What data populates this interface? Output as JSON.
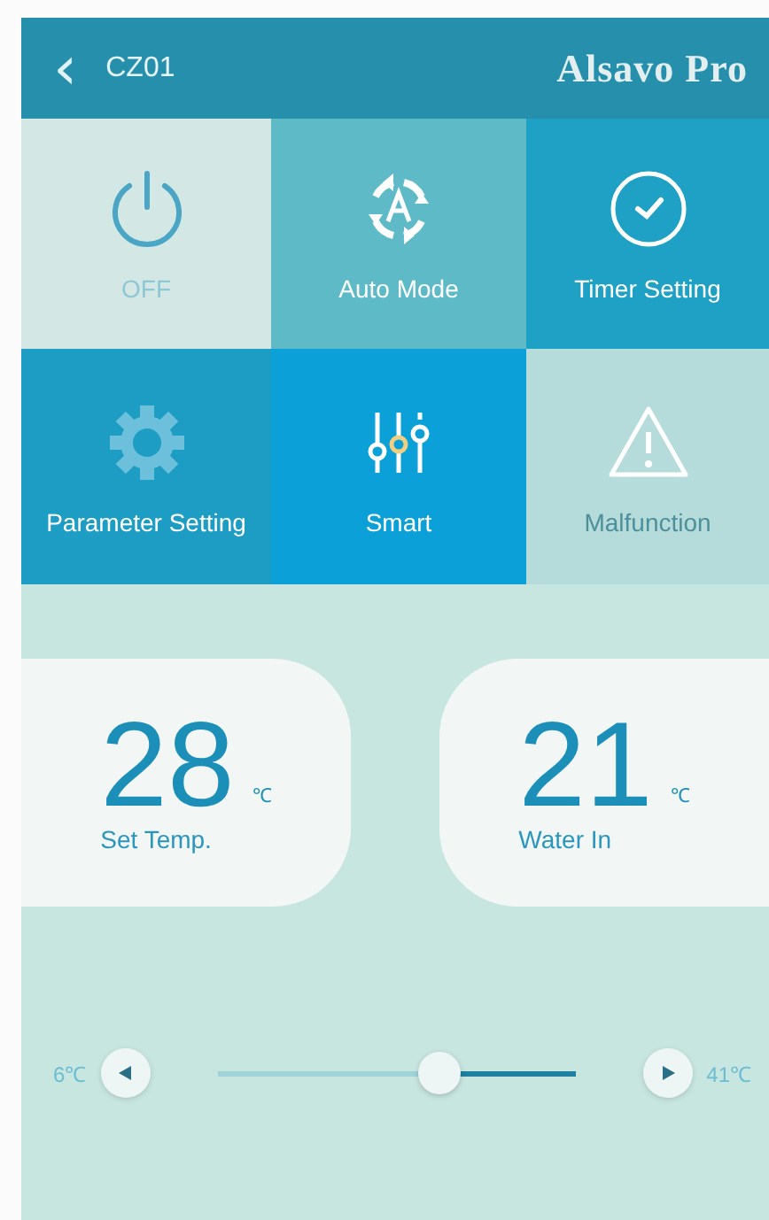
{
  "header": {
    "back_icon": "‹",
    "device": "CZ01",
    "brand": "Alsavo Pro"
  },
  "tiles": [
    {
      "kind": "power",
      "label": "OFF",
      "color": "#d3e8e5"
    },
    {
      "kind": "auto",
      "label": "Auto Mode",
      "color": "#5fbac8"
    },
    {
      "kind": "timer",
      "label": "Timer Setting",
      "color": "#1ea1c4"
    },
    {
      "kind": "gear",
      "label": "Parameter Setting",
      "color": "#1d9dc4"
    },
    {
      "kind": "sliders",
      "label": "Smart",
      "color": "#0ba1d8"
    },
    {
      "kind": "warning",
      "label": "Malfunction",
      "color": "#b5dcdb"
    }
  ],
  "readings": [
    {
      "value": "28",
      "unit": "℃",
      "label": "Set Temp."
    },
    {
      "value": "21",
      "unit": "℃",
      "label": "Water In"
    }
  ],
  "slider": {
    "min_label": "6℃",
    "max_label": "41℃",
    "level": 0.62
  }
}
